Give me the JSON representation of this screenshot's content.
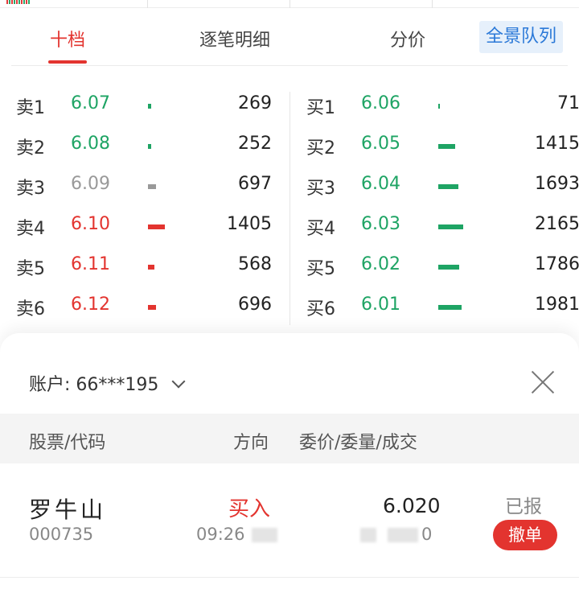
{
  "tabs": [
    {
      "label": "十档",
      "active": true
    },
    {
      "label": "逐笔明细",
      "active": false
    },
    {
      "label": "分价",
      "active": false
    }
  ],
  "panorama_label": "全景队列",
  "colors": {
    "up": "#e3342f",
    "down": "#1ea464",
    "flat": "#999999",
    "accent": "#2b79d8"
  },
  "sell": [
    {
      "label": "卖1",
      "price": "6.07",
      "volume": "269",
      "color": "green"
    },
    {
      "label": "卖2",
      "price": "6.08",
      "volume": "252",
      "color": "green"
    },
    {
      "label": "卖3",
      "price": "6.09",
      "volume": "697",
      "color": "gray"
    },
    {
      "label": "卖4",
      "price": "6.10",
      "volume": "1405",
      "color": "red"
    },
    {
      "label": "卖5",
      "price": "6.11",
      "volume": "568",
      "color": "red"
    },
    {
      "label": "卖6",
      "price": "6.12",
      "volume": "696",
      "color": "red"
    }
  ],
  "buy": [
    {
      "label": "买1",
      "price": "6.06",
      "volume": "71",
      "color": "green"
    },
    {
      "label": "买2",
      "price": "6.05",
      "volume": "1415",
      "color": "green"
    },
    {
      "label": "买3",
      "price": "6.04",
      "volume": "1693",
      "color": "green"
    },
    {
      "label": "买4",
      "price": "6.03",
      "volume": "2165",
      "color": "green"
    },
    {
      "label": "买5",
      "price": "6.02",
      "volume": "1786",
      "color": "green"
    },
    {
      "label": "买6",
      "price": "6.01",
      "volume": "1981",
      "color": "green"
    }
  ],
  "sheet": {
    "account_label": "账户:",
    "account_value": "66***195",
    "headers": {
      "stock": "股票/代码",
      "direction": "方向",
      "detail": "委价/委量/成交"
    },
    "order": {
      "name": "罗牛山",
      "code": "000735",
      "direction": "买入",
      "time": "09:26",
      "price": "6.020",
      "filled": "0",
      "status": "已报",
      "cancel_label": "撤单"
    }
  }
}
